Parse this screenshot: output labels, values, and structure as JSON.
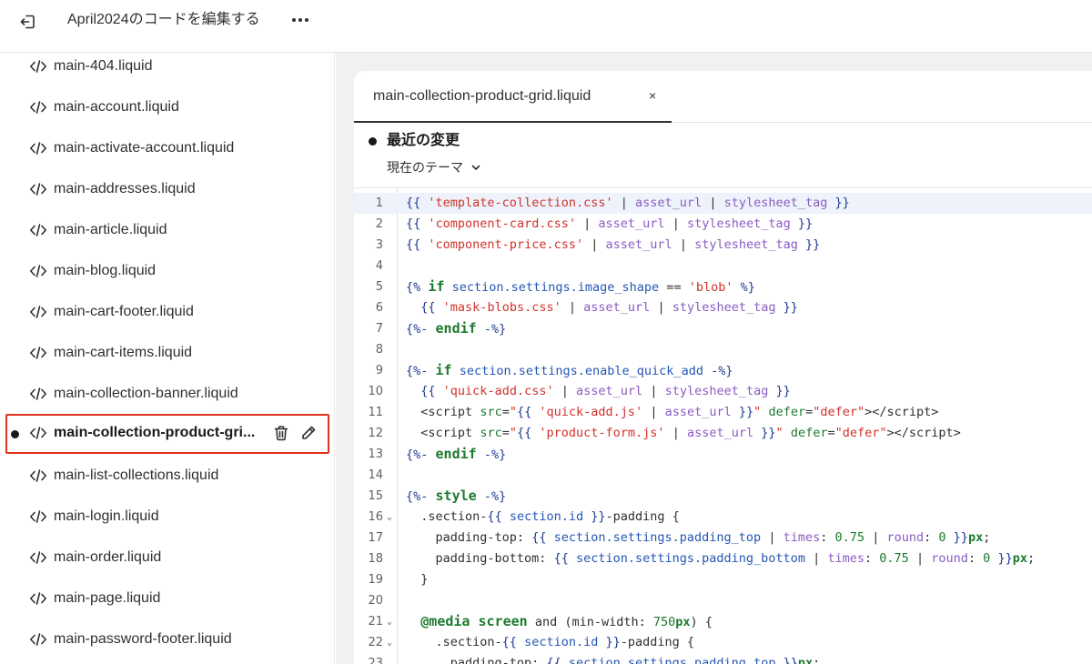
{
  "header": {
    "title": "April2024のコードを編集する"
  },
  "sidebar": {
    "items": [
      {
        "label": "main-404.liquid"
      },
      {
        "label": "main-account.liquid"
      },
      {
        "label": "main-activate-account.liquid"
      },
      {
        "label": "main-addresses.liquid"
      },
      {
        "label": "main-article.liquid"
      },
      {
        "label": "main-blog.liquid"
      },
      {
        "label": "main-cart-footer.liquid"
      },
      {
        "label": "main-cart-items.liquid"
      },
      {
        "label": "main-collection-banner.liquid"
      },
      {
        "label": "main-collection-product-gri..."
      },
      {
        "label": "main-list-collections.liquid"
      },
      {
        "label": "main-login.liquid"
      },
      {
        "label": "main-order.liquid"
      },
      {
        "label": "main-page.liquid"
      },
      {
        "label": "main-password-footer.liquid"
      }
    ]
  },
  "tab": {
    "label": "main-collection-product-grid.liquid",
    "close": "×"
  },
  "changes": {
    "title": "最近の変更",
    "theme": "現在のテーマ"
  },
  "editor": {
    "line_numbers": [
      "1",
      "2",
      "3",
      "4",
      "5",
      "6",
      "7",
      "8",
      "9",
      "10",
      "11",
      "12",
      "13",
      "14",
      "15",
      "16",
      "17",
      "18",
      "19",
      "20",
      "21",
      "22",
      "23"
    ],
    "current_line": 1
  },
  "colors": {
    "highlight_border": "#e0301e",
    "string": "#d0322b",
    "filter": "#8a5cc2",
    "keyword": "#1d7a2e"
  }
}
